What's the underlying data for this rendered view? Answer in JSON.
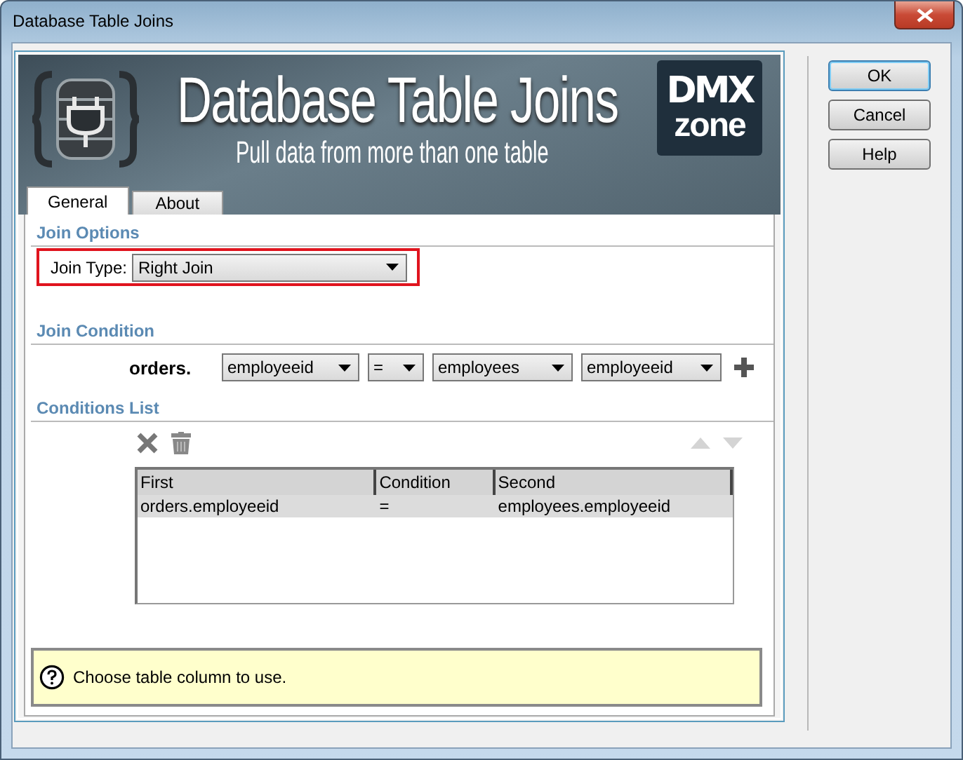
{
  "window": {
    "title": "Database Table Joins"
  },
  "banner": {
    "title": "Database Table Joins",
    "subtitle": "Pull data from more than one table",
    "logo_top": "DMX",
    "logo_bottom": "zone"
  },
  "tabs": [
    {
      "label": "General",
      "selected": true
    },
    {
      "label": "About",
      "selected": false
    }
  ],
  "join_options": {
    "heading": "Join Options",
    "label": "Join Type:",
    "value": "Right Join",
    "highlighted": true
  },
  "join_condition": {
    "heading": "Join Condition",
    "prefix": "orders.",
    "selects": [
      "employeeid",
      "=",
      "employees",
      "employeeid"
    ]
  },
  "conditions_list": {
    "heading": "Conditions List",
    "columns": [
      "First",
      "Condition",
      "Second"
    ],
    "rows": [
      {
        "cells": [
          "orders.employeeid",
          "=",
          "employees.employeeid"
        ],
        "selected": true
      }
    ]
  },
  "hint": "Choose table column to use.",
  "buttons": [
    {
      "label": "OK",
      "default": true
    },
    {
      "label": "Cancel",
      "default": false
    },
    {
      "label": "Help",
      "default": false
    }
  ]
}
